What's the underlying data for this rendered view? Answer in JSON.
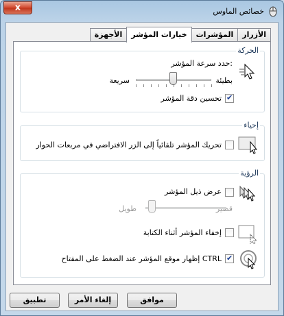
{
  "window": {
    "title": "خصائص الماوس",
    "close_label": "x"
  },
  "tabs": [
    "الأزرار",
    "المؤشرات",
    "خيارات المؤشر",
    "الأجهزة"
  ],
  "active_tab": 2,
  "motion": {
    "legend": "الحركة",
    "speed_heading": "حدد سرعة المؤشر:",
    "slow_label": "بطيئة",
    "fast_label": "سريعة",
    "speed_level": 0.5,
    "precision_label": "تحسين دقة المؤشر",
    "precision_checked": true
  },
  "snapto": {
    "legend": "إحياء",
    "label": "تحريك المؤشر تلقائياً إلى الزر الافتراضي في مربعات الحوار",
    "checked": false
  },
  "visibility": {
    "legend": "الرؤية",
    "trails_label": "عرض ذيل المؤشر",
    "trails_checked": false,
    "short_label": "قصير",
    "long_label": "طويل",
    "trails_level": 0,
    "hide_label": "إخفاء المؤشر أثناء الكتابة",
    "hide_checked": false,
    "ctrl_label": "إظهار موقع المؤشر عند الضغط على المفتاح CTRL",
    "ctrl_checked": true
  },
  "buttons": {
    "ok": "موافق",
    "cancel": "إلغاء الأمر",
    "apply": "تطبيق"
  },
  "colors": {
    "accent": "#1e395b",
    "frame": "#a9c7e2"
  }
}
